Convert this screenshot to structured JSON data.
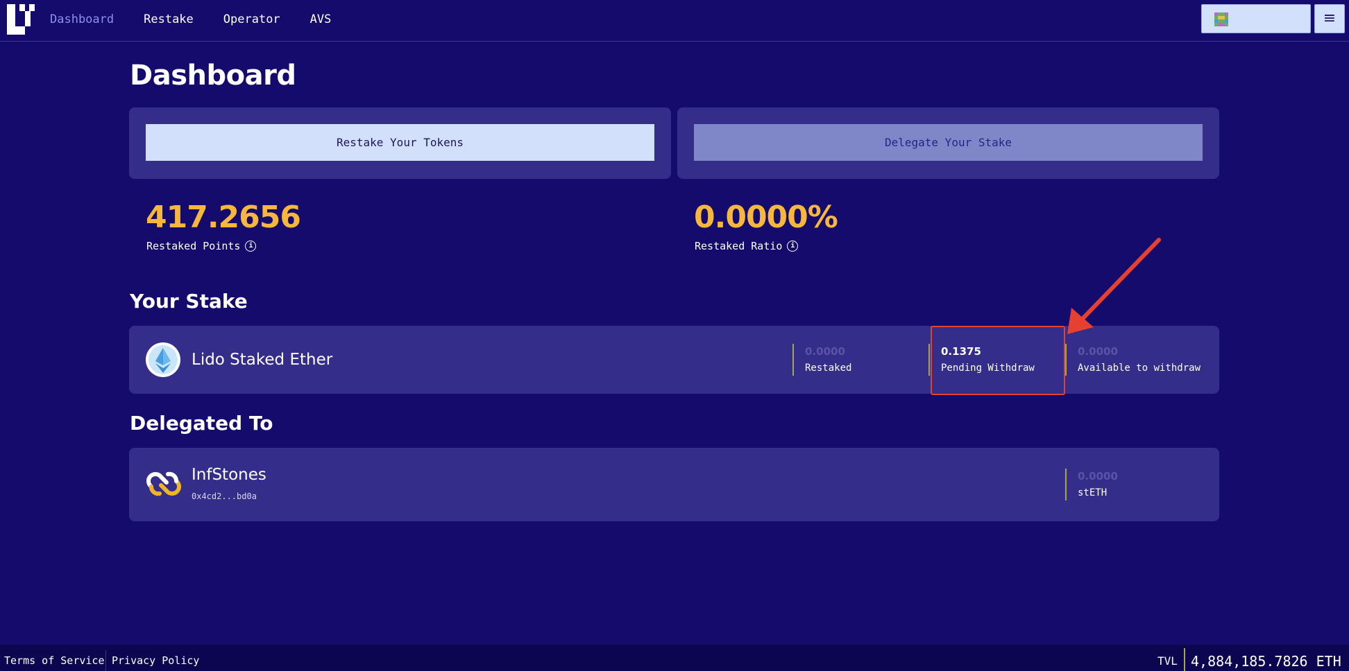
{
  "nav": {
    "items": [
      {
        "label": "Dashboard",
        "active": true
      },
      {
        "label": "Restake",
        "active": false
      },
      {
        "label": "Operator",
        "active": false
      },
      {
        "label": "AVS",
        "active": false
      }
    ],
    "logo_icon": "eigenlayer-logo-icon",
    "wallet_avatar_icon": "pixel-avatar-icon",
    "menu_icon": "≡"
  },
  "page": {
    "title": "Dashboard"
  },
  "actions": {
    "restake_label": "Restake Your Tokens",
    "delegate_label": "Delegate Your Stake"
  },
  "stats": {
    "restaked_points_value": "417.2656",
    "restaked_points_label": "Restaked Points",
    "restaked_ratio_value": "0.0000%",
    "restaked_ratio_label": "Restaked Ratio",
    "info_icon": "i"
  },
  "your_stake": {
    "title": "Your Stake",
    "token_name": "Lido Staked Ether",
    "token_icon": "steth-icon",
    "restaked_value": "0.0000",
    "restaked_label": "Restaked",
    "pending_value": "0.1375",
    "pending_label": "Pending Withdraw",
    "available_value": "0.0000",
    "available_label": "Available to withdraw"
  },
  "delegated_to": {
    "title": "Delegated To",
    "operator_name": "InfStones",
    "operator_address": "0x4cd2...bd0a",
    "operator_icon": "infstones-icon",
    "amount_value": "0.0000",
    "amount_label": "stETH"
  },
  "footer": {
    "terms": "Terms of Service",
    "privacy": "Privacy Policy",
    "tvl_label": "TVL",
    "tvl_value": "4,884,185.7826 ETH"
  },
  "colors": {
    "background": "#150b6c",
    "card": "#352d8a",
    "accent_orange": "#f6b73c",
    "callout_red": "#e64031"
  }
}
